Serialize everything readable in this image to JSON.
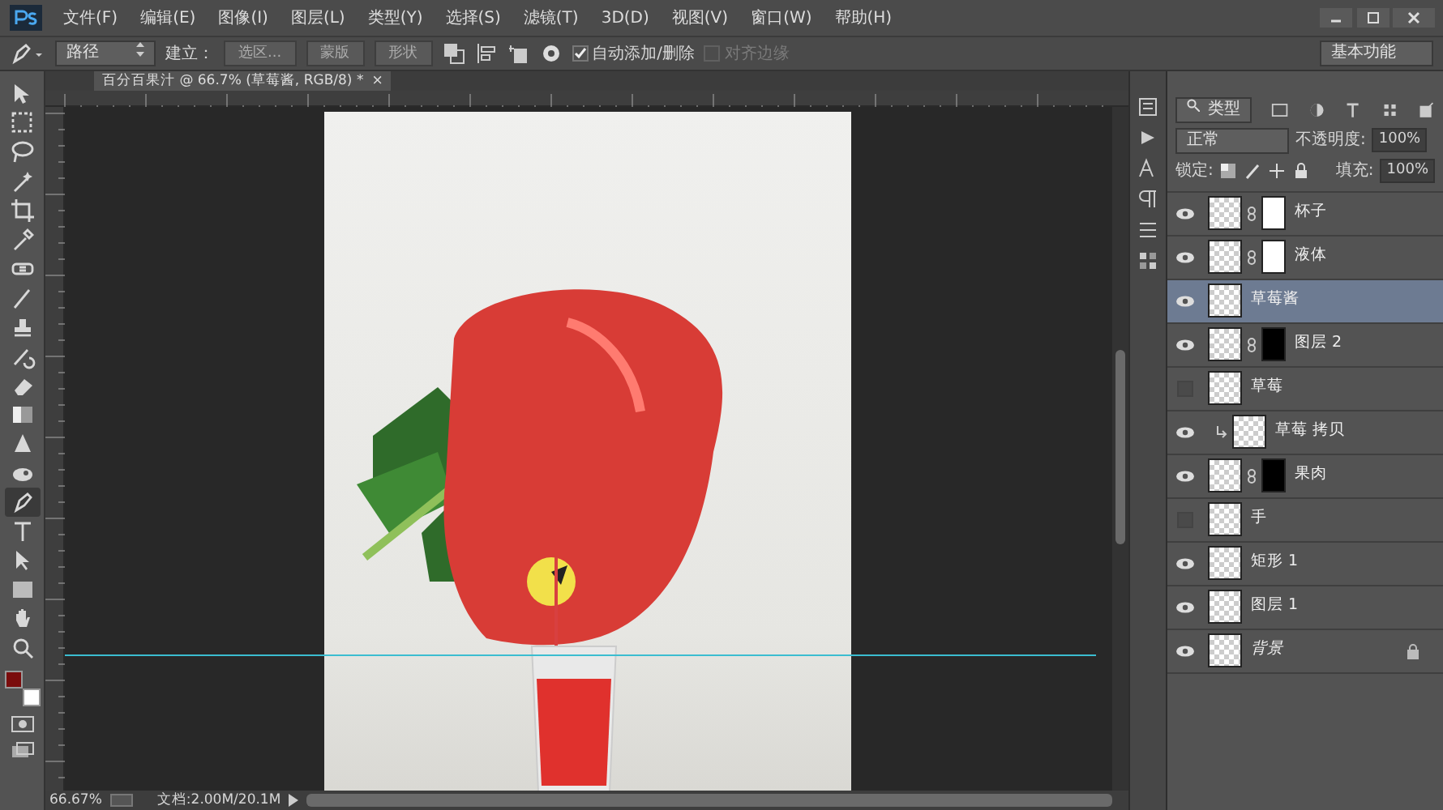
{
  "menu": [
    "文件(F)",
    "编辑(E)",
    "图像(I)",
    "图层(L)",
    "类型(Y)",
    "选择(S)",
    "滤镜(T)",
    "3D(D)",
    "视图(V)",
    "窗口(W)",
    "帮助(H)"
  ],
  "options": {
    "mode": "路径",
    "make_label": "建立：",
    "buttons": [
      "选区...",
      "蒙版",
      "形状"
    ],
    "auto_add": {
      "label": "自动添加/删除",
      "checked": true,
      "disabled": false
    },
    "align_edges": {
      "label": "对齐边缘",
      "checked": false,
      "disabled": true
    },
    "workspace": "基本功能"
  },
  "document_tab": {
    "title": "百分百果汁 @ 66.7% (草莓酱, RGB/8) *",
    "close": "×"
  },
  "tools": [
    {
      "kind": "move",
      "selected": false
    },
    {
      "kind": "marquee",
      "selected": false
    },
    {
      "kind": "lasso",
      "selected": false
    },
    {
      "kind": "wand",
      "selected": false
    },
    {
      "kind": "crop",
      "selected": false
    },
    {
      "kind": "eyedropper",
      "selected": false
    },
    {
      "kind": "heal",
      "selected": false
    },
    {
      "kind": "brush",
      "selected": false
    },
    {
      "kind": "stamp",
      "selected": false
    },
    {
      "kind": "history",
      "selected": false
    },
    {
      "kind": "eraser",
      "selected": false
    },
    {
      "kind": "gradient",
      "selected": false
    },
    {
      "kind": "blur",
      "selected": false
    },
    {
      "kind": "dodge",
      "selected": false
    },
    {
      "kind": "pen",
      "selected": true
    },
    {
      "kind": "type",
      "selected": false
    },
    {
      "kind": "select",
      "selected": false
    },
    {
      "kind": "shape",
      "selected": false
    },
    {
      "kind": "hand",
      "selected": false
    },
    {
      "kind": "zoom",
      "selected": false
    }
  ],
  "swatches": [
    {
      "kind": "foreground",
      "color": "#7a0c0c"
    },
    {
      "kind": "background",
      "color": "#ffffff"
    }
  ],
  "layers_panel": {
    "filter": "类型",
    "blend_mode": "正常",
    "opacity_label": "不透明度:",
    "opacity": "100%",
    "lock_label": "锁定:",
    "fill_label": "填充:",
    "fill": "100%",
    "layers": [
      {
        "name": "杯子",
        "visible": true,
        "selected": false,
        "clipped": false,
        "mask": {
          "kind": "light"
        },
        "locked": false
      },
      {
        "name": "液体",
        "visible": true,
        "selected": false,
        "clipped": false,
        "mask": {
          "kind": "light"
        },
        "locked": false
      },
      {
        "name": "草莓酱",
        "visible": true,
        "selected": true,
        "clipped": false,
        "locked": false
      },
      {
        "name": "图层 2",
        "visible": true,
        "selected": false,
        "clipped": false,
        "mask": {
          "kind": "dark"
        },
        "locked": false
      },
      {
        "name": "草莓",
        "visible": false,
        "selected": false,
        "clipped": false,
        "locked": false
      },
      {
        "name": "草莓 拷贝",
        "visible": true,
        "selected": false,
        "clipped": true,
        "locked": false
      },
      {
        "name": "果肉",
        "visible": true,
        "selected": false,
        "clipped": false,
        "mask": {
          "kind": "dark"
        },
        "locked": false
      },
      {
        "name": "手",
        "visible": false,
        "selected": false,
        "clipped": false,
        "locked": false
      },
      {
        "name": "矩形 1",
        "visible": true,
        "selected": false,
        "clipped": false,
        "locked": false
      },
      {
        "name": "图层 1",
        "visible": true,
        "selected": false,
        "clipped": false,
        "locked": false
      },
      {
        "name": "背景",
        "visible": true,
        "selected": false,
        "clipped": false,
        "locked": true
      }
    ]
  },
  "status_bar": {
    "zoom": "66.67%",
    "doc_size": "文档:2.00M/20.1M"
  }
}
